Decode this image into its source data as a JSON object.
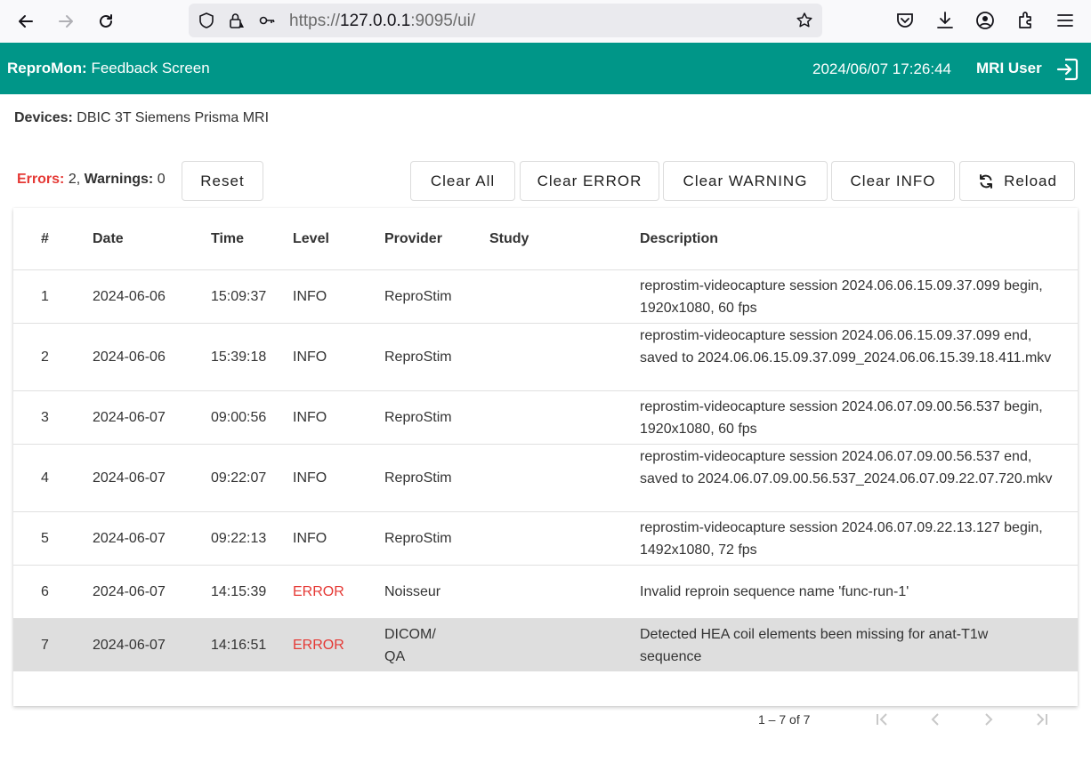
{
  "browser": {
    "url_prefix": "https://",
    "url_host": "127.0.0.1",
    "url_rest": ":9095/ui/"
  },
  "header": {
    "brand": "ReproMon:",
    "title": "Feedback Screen",
    "datetime": "2024/06/07 17:26:44",
    "user": "MRI User"
  },
  "devices": {
    "label": "Devices:",
    "value": "DBIC 3T Siemens Prisma MRI"
  },
  "counts": {
    "errors_label": "Errors:",
    "errors_value": "2",
    "separator": ",",
    "warnings_label": "Warnings:",
    "warnings_value": "0"
  },
  "buttons": {
    "reset": "Reset",
    "clear_all": "Clear All",
    "clear_error": "Clear ERROR",
    "clear_warning": "Clear WARNING",
    "clear_info": "Clear INFO",
    "reload": "Reload"
  },
  "table": {
    "headers": [
      "#",
      "Date",
      "Time",
      "Level",
      "Provider",
      "Study",
      "Description"
    ],
    "rows": [
      {
        "num": "1",
        "date": "2024-06-06",
        "time": "15:09:37",
        "level": "INFO",
        "provider": "ReproStim",
        "study": "",
        "desc": "reprostim-videocapture session 2024.06.06.15.09.37.099 begin, 1920x1080, 60 fps"
      },
      {
        "num": "2",
        "date": "2024-06-06",
        "time": "15:39:18",
        "level": "INFO",
        "provider": "ReproStim",
        "study": "",
        "desc": "reprostim-videocapture session 2024.06.06.15.09.37.099 end, saved to 2024.06.06.15.09.37.099_2024.06.06.15.39.18.411.mkv"
      },
      {
        "num": "3",
        "date": "2024-06-07",
        "time": "09:00:56",
        "level": "INFO",
        "provider": "ReproStim",
        "study": "",
        "desc": "reprostim-videocapture session 2024.06.07.09.00.56.537 begin, 1920x1080, 60 fps"
      },
      {
        "num": "4",
        "date": "2024-06-07",
        "time": "09:22:07",
        "level": "INFO",
        "provider": "ReproStim",
        "study": "",
        "desc": "reprostim-videocapture session 2024.06.07.09.00.56.537 end, saved to 2024.06.07.09.00.56.537_2024.06.07.09.22.07.720.mkv"
      },
      {
        "num": "5",
        "date": "2024-06-07",
        "time": "09:22:13",
        "level": "INFO",
        "provider": "ReproStim",
        "study": "",
        "desc": "reprostim-videocapture session 2024.06.07.09.22.13.127 begin, 1492x1080, 72 fps"
      },
      {
        "num": "6",
        "date": "2024-06-07",
        "time": "14:15:39",
        "level": "ERROR",
        "provider": "Noisseur",
        "study": "",
        "desc": "Invalid reproin sequence name 'func-run-1'"
      },
      {
        "num": "7",
        "date": "2024-06-07",
        "time": "14:16:51",
        "level": "ERROR",
        "provider": "DICOM/ QA",
        "study": "",
        "desc": "Detected HEA coil elements been missing for anat-T1w sequence"
      }
    ]
  },
  "pager": {
    "range": "1 – 7 of 7"
  },
  "colors": {
    "header_bg": "#009688",
    "error": "#e53935",
    "selected_row": "#dedede"
  }
}
